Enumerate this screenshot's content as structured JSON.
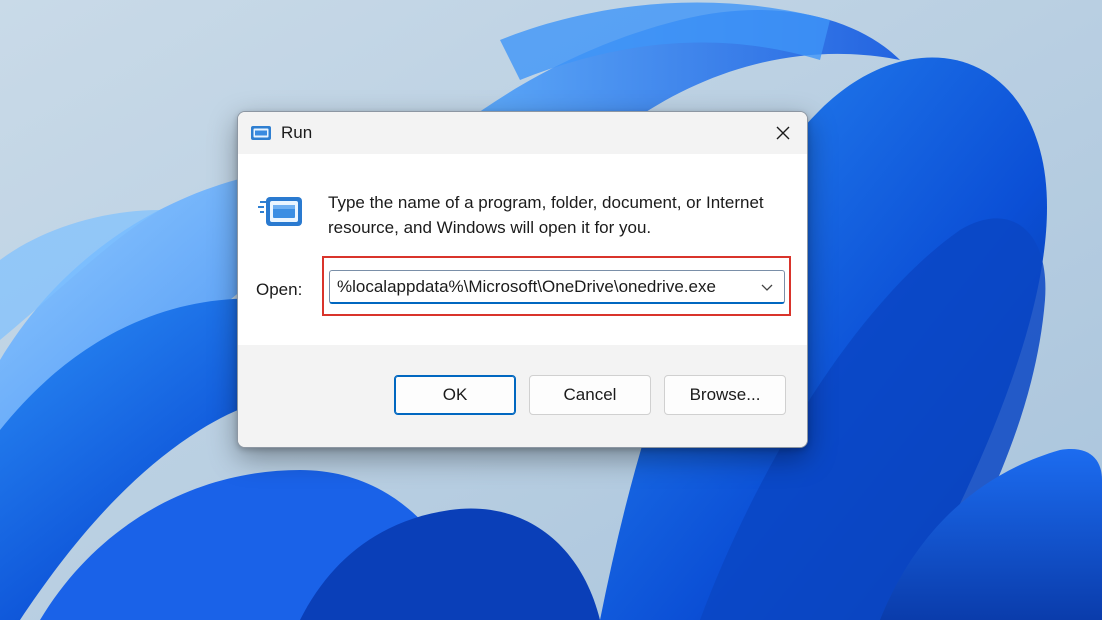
{
  "dialog": {
    "title": "Run",
    "description": "Type the name of a program, folder, document, or Internet resource, and Windows will open it for you.",
    "open_label": "Open:",
    "command_value": "%localappdata%\\Microsoft\\OneDrive\\onedrive.exe",
    "buttons": {
      "ok": "OK",
      "cancel": "Cancel",
      "browse": "Browse..."
    }
  },
  "icons": {
    "title": "run-icon",
    "main": "run-icon",
    "close": "close-icon",
    "dropdown": "chevron-down-icon"
  },
  "colors": {
    "accent": "#0067c0",
    "highlight_box": "#d9342b",
    "wallpaper_sky": "#b9cfe2",
    "wallpaper_bloom": "#1565e8"
  }
}
